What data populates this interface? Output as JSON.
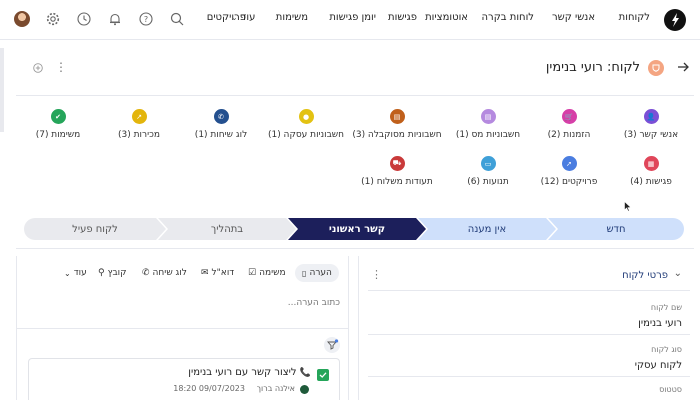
{
  "nav": {
    "items": [
      "לקוחות",
      "אנשי קשר",
      "לוחות בקרה",
      "אוטומציות",
      "פגישות",
      "יומן פגישות",
      "משימות",
      "פרויקטים"
    ],
    "more_label": "עוד"
  },
  "header": {
    "title": "לקוח: רועי בנימין"
  },
  "tiles": [
    {
      "label": "אנשי קשר (3)",
      "color": "#7b4fd6"
    },
    {
      "label": "הזמנות (2)",
      "color": "#d63fa8"
    },
    {
      "label": "חשבוניות מס (1)",
      "color": "#b58adf"
    },
    {
      "label": "חשבוניות מסוקבלה (3)",
      "color": "#c0601b"
    },
    {
      "label": "חשבוניות עסקה (1)",
      "color": "#e3c212"
    },
    {
      "label": "לוג שיחות (1)",
      "color": "#24508f"
    },
    {
      "label": "מכירות (3)",
      "color": "#e3b50c"
    },
    {
      "label": "משימות (7)",
      "color": "#25a55a"
    },
    {
      "label": "פגישות (4)",
      "color": "#e0465a"
    },
    {
      "label": "פרויקטים (12)",
      "color": "#4a7de0"
    },
    {
      "label": "תנועות (6)",
      "color": "#3fa0d8"
    },
    {
      "label": "תעודות משלוח (1)",
      "color": "#c93a3a"
    }
  ],
  "stages": [
    "חדש",
    "אין מענה",
    "קשר ראשוני",
    "בתהליך",
    "לקוח פעיל"
  ],
  "activity": {
    "tabs": [
      "הערה",
      "משימה",
      "דוא\"ל",
      "לוג שיחה",
      "קובץ"
    ],
    "more_label": "עוד",
    "placeholder": "כתוב הערה...",
    "item_title": "ליצור קשר עם רועי בנימין",
    "item_author": "אילנה ברוך",
    "item_time": "18:20 09/07/2023"
  },
  "details": {
    "title": "פרטי לקוח",
    "fields": [
      {
        "label": "שם לקוח",
        "value": "רועי בנימין"
      },
      {
        "label": "סוג לקוח",
        "value": "לקוח עסקי"
      },
      {
        "label": "סטטוס",
        "value": ""
      }
    ]
  }
}
